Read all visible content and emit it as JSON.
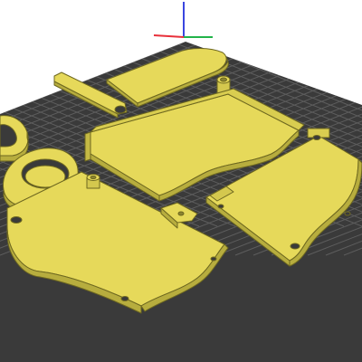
{
  "viewport": {
    "background_color": "#ffffff",
    "bed_color": "#3a3a3a",
    "bed_grid_color": "#7a7a7a",
    "part_fill_color": "#e6d95a",
    "part_edge_color": "#6e6820",
    "axis_colors": {
      "x": "#e8303a",
      "y": "#22b44a",
      "z": "#3a46e0"
    }
  },
  "parts": [
    {
      "name": "ring-piece"
    },
    {
      "name": "thin-arm"
    },
    {
      "name": "round-tab"
    },
    {
      "name": "long-clip"
    },
    {
      "name": "peg-post"
    },
    {
      "name": "back-panel-with-rim"
    },
    {
      "name": "right-panel"
    },
    {
      "name": "oval-cup"
    },
    {
      "name": "left-panel"
    },
    {
      "name": "small-bracket"
    }
  ]
}
